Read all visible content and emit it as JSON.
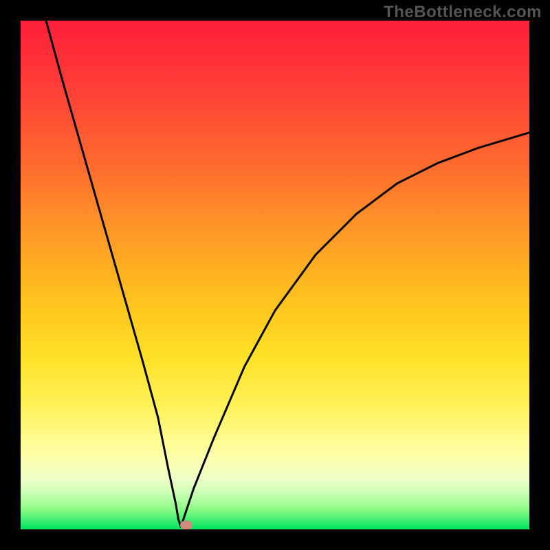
{
  "watermark": "TheBottleneck.com",
  "chart_data": {
    "type": "line",
    "title": "",
    "xlabel": "",
    "ylabel": "",
    "xlim": [
      0,
      100
    ],
    "ylim": [
      0,
      100
    ],
    "grid": false,
    "series": [
      {
        "name": "bottleneck-curve",
        "x": [
          5,
          8,
          12,
          16,
          20,
          24,
          27,
          29,
          30.5,
          31,
          31.5,
          32,
          34,
          38,
          44,
          50,
          58,
          66,
          74,
          82,
          90,
          100
        ],
        "values": [
          100,
          89,
          75,
          61,
          47,
          33,
          22,
          12,
          5,
          2,
          0.5,
          2,
          8,
          18,
          32,
          43,
          54,
          62,
          68,
          72,
          75,
          78
        ]
      }
    ],
    "marker": {
      "x": 32.5,
      "y": 0.8,
      "color": "#cf8b7c"
    },
    "gradient_stops": [
      {
        "pos": 0,
        "color": "#ff1f3a"
      },
      {
        "pos": 55,
        "color": "#ffc21e"
      },
      {
        "pos": 85,
        "color": "#ffffa5"
      },
      {
        "pos": 100,
        "color": "#00e560"
      }
    ]
  }
}
